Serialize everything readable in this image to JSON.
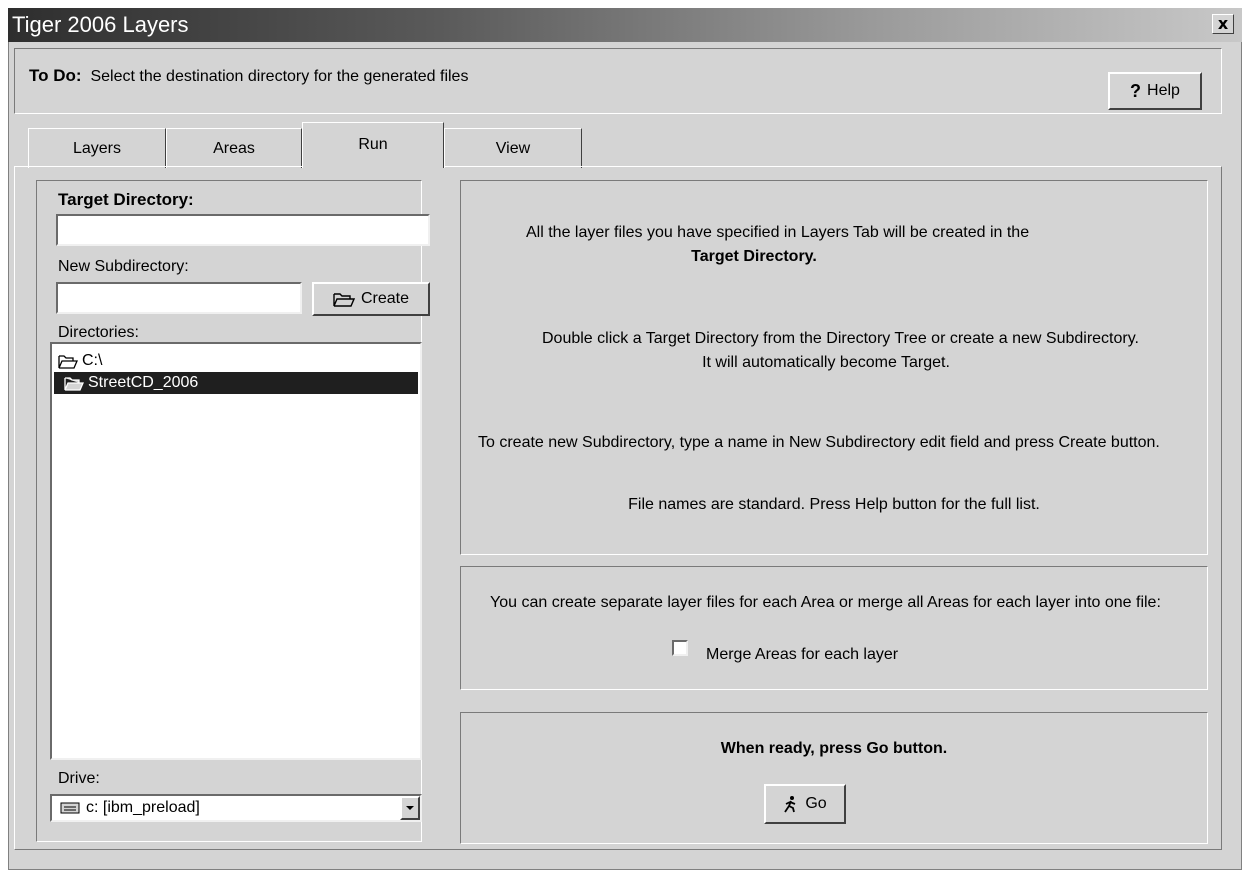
{
  "window": {
    "title": "Tiger 2006 Layers",
    "close_glyph": "x"
  },
  "todo": {
    "label": "To Do:",
    "text": "Select the destination directory for the generated files"
  },
  "help_button": {
    "icon": "question-icon",
    "glyph": "?",
    "label": "Help"
  },
  "tabs": [
    {
      "label": "Layers",
      "active": false
    },
    {
      "label": "Areas",
      "active": false
    },
    {
      "label": "Run",
      "active": true
    },
    {
      "label": "View",
      "active": false
    }
  ],
  "left": {
    "target_label": "Target Directory:",
    "target_value": "",
    "subdir_label": "New Subdirectory:",
    "subdir_value": "",
    "create_button": {
      "icon": "folder-open-icon",
      "label": "Create"
    },
    "directories_label": "Directories:",
    "directories": [
      {
        "name": "C:\\",
        "icon": "folder-open-icon",
        "selected": false
      },
      {
        "name": "StreetCD_2006",
        "icon": "folder-open-icon",
        "selected": true
      }
    ],
    "drive_label": "Drive:",
    "drive_value": "c: [ibm_preload]",
    "drive_icon": "drive-icon"
  },
  "info": {
    "line1": "All the layer files you have specified in Layers Tab  will be created in the",
    "line2": "Target Directory.",
    "line3": "Double click a Target Directory from the Directory Tree or create a new Subdirectory.",
    "line4": "It will automatically become Target.",
    "line5": "To create new Subdirectory, type a name in New Subdirectory  edit field and press Create button.",
    "line6": "File names are standard. Press Help button for the full list."
  },
  "merge": {
    "text": "You can create separate layer files for each Area  or merge all Areas for each layer into one file:",
    "checkbox_label": "Merge Areas for each layer",
    "checked": false
  },
  "go": {
    "text": "When ready, press Go button.",
    "button": {
      "icon": "running-man-icon",
      "label": "Go"
    }
  }
}
